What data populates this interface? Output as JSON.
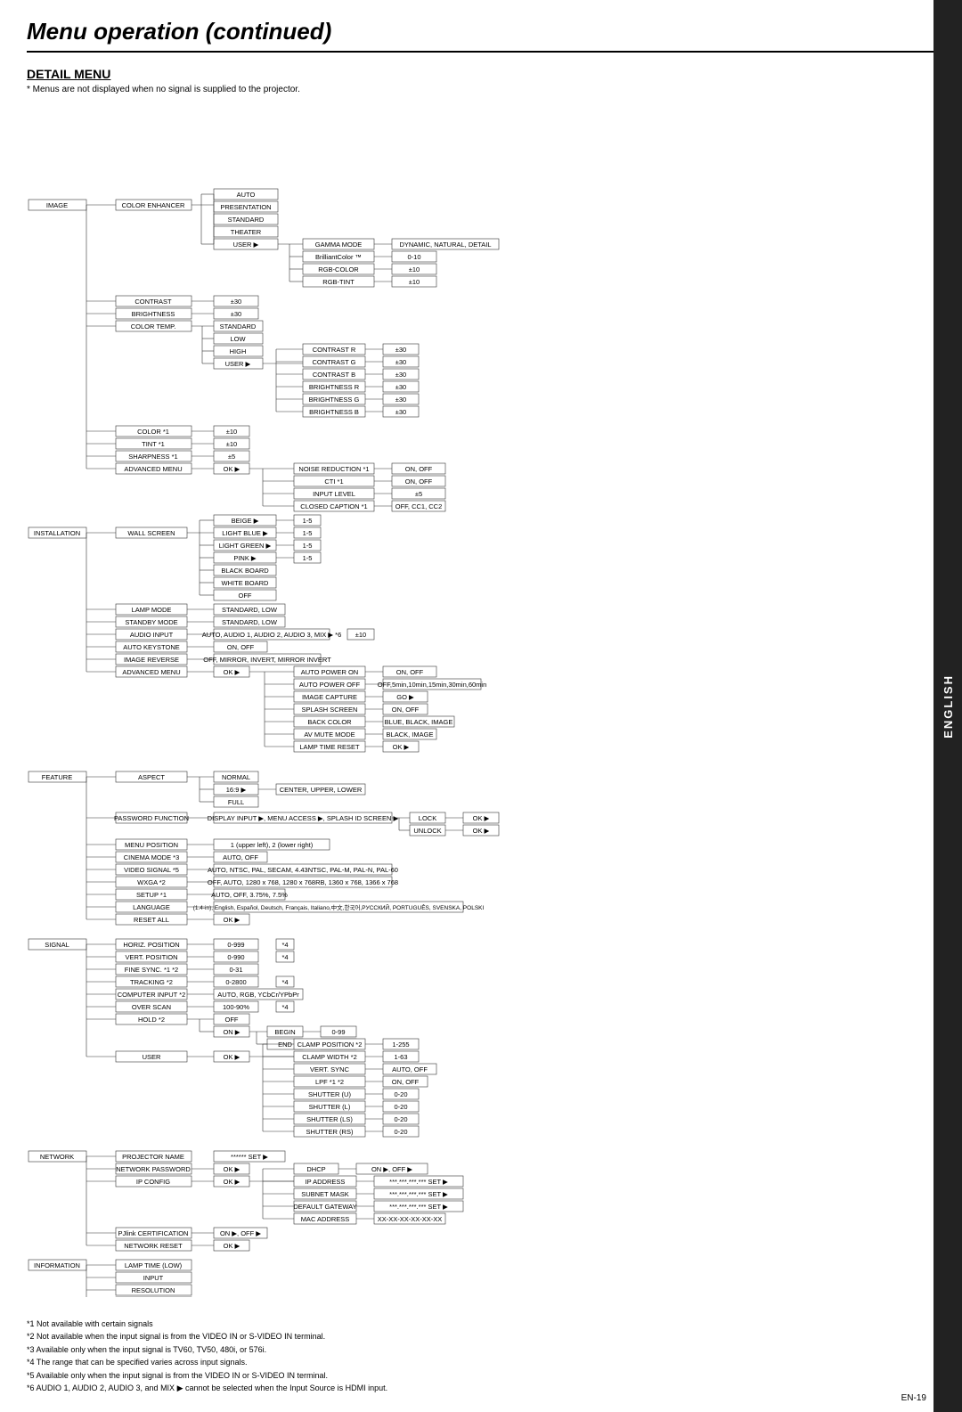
{
  "page": {
    "title": "Menu operation (continued)",
    "section": "DETAIL MENU",
    "subtitle": "* Menus are not displayed when no signal is supplied to the projector.",
    "sidebar_label": "ENGLISH",
    "page_number": "EN-19"
  },
  "footnotes": [
    "*1 Not available with certain signals",
    "*2 Not available when the input signal is from the VIDEO IN or S-VIDEO IN terminal.",
    "*3 Available only when the input signal is TV60, TV50, 480i, or 576i.",
    "*4 The range that can be specified varies across input signals.",
    "*5 Available only when the input signal is from the VIDEO IN or S-VIDEO IN terminal.",
    "*6 AUDIO 1, AUDIO 2, AUDIO 3, and MIX ▶ cannot be selected when the Input Source is HDMI input."
  ]
}
